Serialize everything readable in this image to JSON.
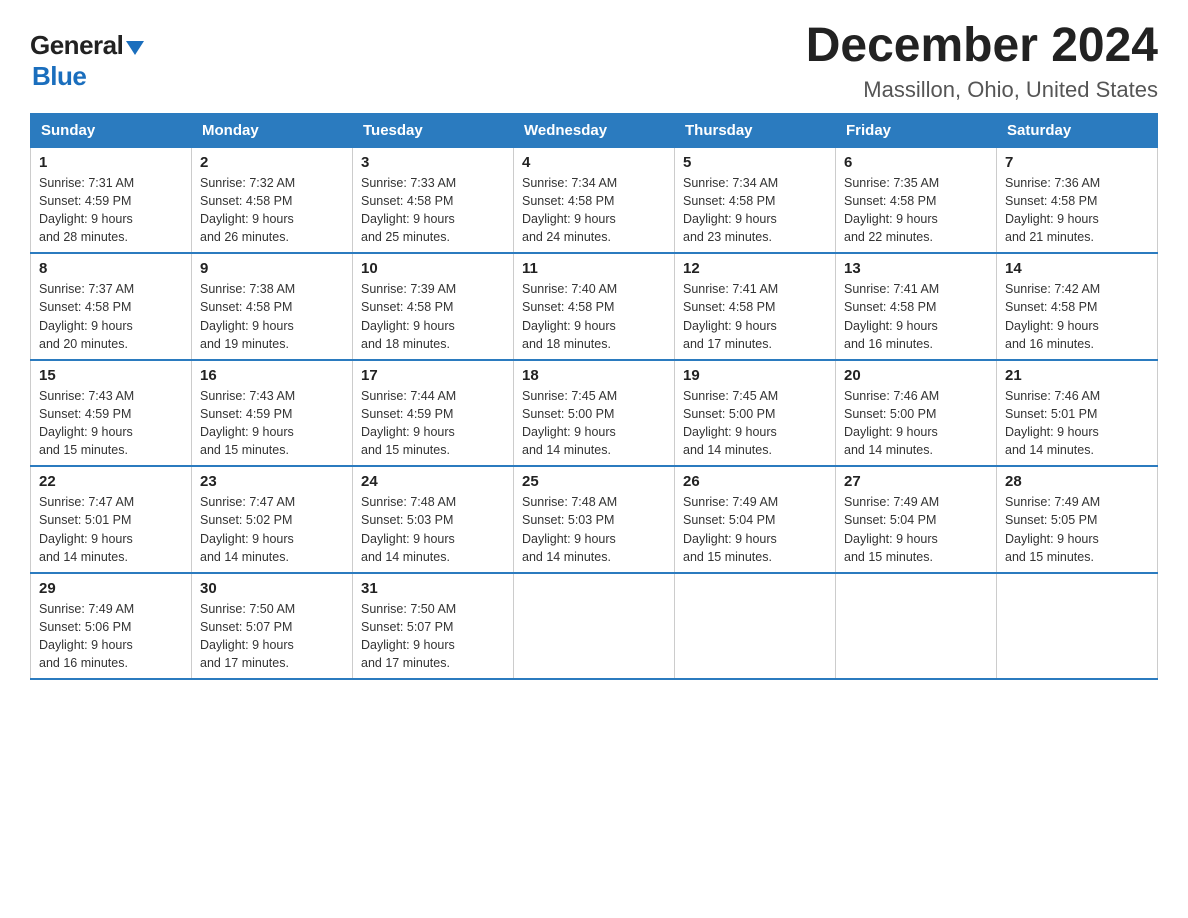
{
  "header": {
    "logo_general": "General",
    "logo_blue": "Blue",
    "title": "December 2024",
    "subtitle": "Massillon, Ohio, United States"
  },
  "days_of_week": [
    "Sunday",
    "Monday",
    "Tuesday",
    "Wednesday",
    "Thursday",
    "Friday",
    "Saturday"
  ],
  "weeks": [
    [
      {
        "day": "1",
        "sunrise": "7:31 AM",
        "sunset": "4:59 PM",
        "daylight": "9 hours and 28 minutes."
      },
      {
        "day": "2",
        "sunrise": "7:32 AM",
        "sunset": "4:58 PM",
        "daylight": "9 hours and 26 minutes."
      },
      {
        "day": "3",
        "sunrise": "7:33 AM",
        "sunset": "4:58 PM",
        "daylight": "9 hours and 25 minutes."
      },
      {
        "day": "4",
        "sunrise": "7:34 AM",
        "sunset": "4:58 PM",
        "daylight": "9 hours and 24 minutes."
      },
      {
        "day": "5",
        "sunrise": "7:34 AM",
        "sunset": "4:58 PM",
        "daylight": "9 hours and 23 minutes."
      },
      {
        "day": "6",
        "sunrise": "7:35 AM",
        "sunset": "4:58 PM",
        "daylight": "9 hours and 22 minutes."
      },
      {
        "day": "7",
        "sunrise": "7:36 AM",
        "sunset": "4:58 PM",
        "daylight": "9 hours and 21 minutes."
      }
    ],
    [
      {
        "day": "8",
        "sunrise": "7:37 AM",
        "sunset": "4:58 PM",
        "daylight": "9 hours and 20 minutes."
      },
      {
        "day": "9",
        "sunrise": "7:38 AM",
        "sunset": "4:58 PM",
        "daylight": "9 hours and 19 minutes."
      },
      {
        "day": "10",
        "sunrise": "7:39 AM",
        "sunset": "4:58 PM",
        "daylight": "9 hours and 18 minutes."
      },
      {
        "day": "11",
        "sunrise": "7:40 AM",
        "sunset": "4:58 PM",
        "daylight": "9 hours and 18 minutes."
      },
      {
        "day": "12",
        "sunrise": "7:41 AM",
        "sunset": "4:58 PM",
        "daylight": "9 hours and 17 minutes."
      },
      {
        "day": "13",
        "sunrise": "7:41 AM",
        "sunset": "4:58 PM",
        "daylight": "9 hours and 16 minutes."
      },
      {
        "day": "14",
        "sunrise": "7:42 AM",
        "sunset": "4:58 PM",
        "daylight": "9 hours and 16 minutes."
      }
    ],
    [
      {
        "day": "15",
        "sunrise": "7:43 AM",
        "sunset": "4:59 PM",
        "daylight": "9 hours and 15 minutes."
      },
      {
        "day": "16",
        "sunrise": "7:43 AM",
        "sunset": "4:59 PM",
        "daylight": "9 hours and 15 minutes."
      },
      {
        "day": "17",
        "sunrise": "7:44 AM",
        "sunset": "4:59 PM",
        "daylight": "9 hours and 15 minutes."
      },
      {
        "day": "18",
        "sunrise": "7:45 AM",
        "sunset": "5:00 PM",
        "daylight": "9 hours and 14 minutes."
      },
      {
        "day": "19",
        "sunrise": "7:45 AM",
        "sunset": "5:00 PM",
        "daylight": "9 hours and 14 minutes."
      },
      {
        "day": "20",
        "sunrise": "7:46 AM",
        "sunset": "5:00 PM",
        "daylight": "9 hours and 14 minutes."
      },
      {
        "day": "21",
        "sunrise": "7:46 AM",
        "sunset": "5:01 PM",
        "daylight": "9 hours and 14 minutes."
      }
    ],
    [
      {
        "day": "22",
        "sunrise": "7:47 AM",
        "sunset": "5:01 PM",
        "daylight": "9 hours and 14 minutes."
      },
      {
        "day": "23",
        "sunrise": "7:47 AM",
        "sunset": "5:02 PM",
        "daylight": "9 hours and 14 minutes."
      },
      {
        "day": "24",
        "sunrise": "7:48 AM",
        "sunset": "5:03 PM",
        "daylight": "9 hours and 14 minutes."
      },
      {
        "day": "25",
        "sunrise": "7:48 AM",
        "sunset": "5:03 PM",
        "daylight": "9 hours and 14 minutes."
      },
      {
        "day": "26",
        "sunrise": "7:49 AM",
        "sunset": "5:04 PM",
        "daylight": "9 hours and 15 minutes."
      },
      {
        "day": "27",
        "sunrise": "7:49 AM",
        "sunset": "5:04 PM",
        "daylight": "9 hours and 15 minutes."
      },
      {
        "day": "28",
        "sunrise": "7:49 AM",
        "sunset": "5:05 PM",
        "daylight": "9 hours and 15 minutes."
      }
    ],
    [
      {
        "day": "29",
        "sunrise": "7:49 AM",
        "sunset": "5:06 PM",
        "daylight": "9 hours and 16 minutes."
      },
      {
        "day": "30",
        "sunrise": "7:50 AM",
        "sunset": "5:07 PM",
        "daylight": "9 hours and 17 minutes."
      },
      {
        "day": "31",
        "sunrise": "7:50 AM",
        "sunset": "5:07 PM",
        "daylight": "9 hours and 17 minutes."
      },
      null,
      null,
      null,
      null
    ]
  ],
  "labels": {
    "sunrise": "Sunrise:",
    "sunset": "Sunset:",
    "daylight": "Daylight:"
  }
}
